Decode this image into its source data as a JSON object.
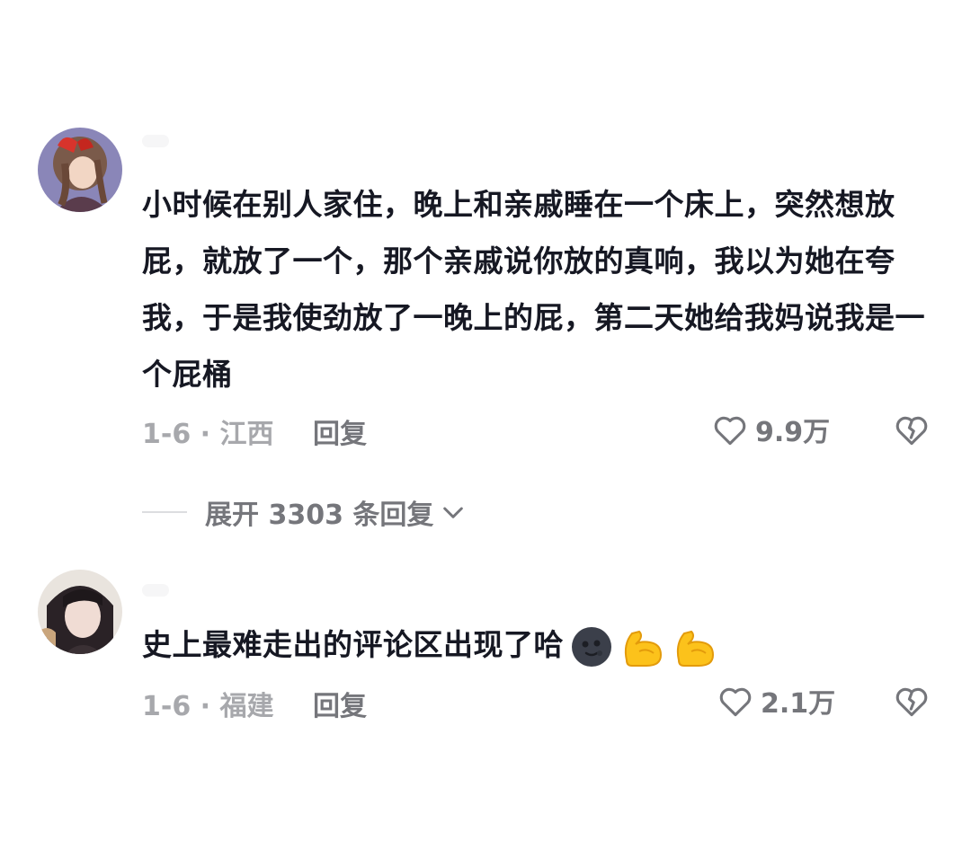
{
  "comments": [
    {
      "text": "小时候在别人家住，晚上和亲戚睡在一个床上，突然想放屁，就放了一个，那个亲戚说你放的真响，我以为她在夸我，于是我使劲放了一晚上的屁，第二天她给我妈说我是一个屁桶",
      "meta": "1-6 · 江西",
      "reply_label": "回复",
      "likes": "9.9万",
      "avatar_icon": "avatar-anime-girl-red-bow",
      "expand_label": "展开 3303 条回复"
    },
    {
      "text": "史上最难走出的评论区出现了哈",
      "emojis": [
        "dark-moon-face-icon",
        "flexed-biceps-icon",
        "flexed-biceps-icon"
      ],
      "meta": "1-6 · 福建",
      "reply_label": "回复",
      "likes": "2.1万",
      "avatar_icon": "avatar-photo-girl"
    }
  ],
  "icons": {
    "like": "heart-outline-icon",
    "dislike": "broken-heart-outline-icon",
    "expand": "chevron-down-icon"
  },
  "colors": {
    "text_primary": "#161823",
    "text_secondary": "#75767b",
    "text_muted": "#a7a8ac"
  }
}
